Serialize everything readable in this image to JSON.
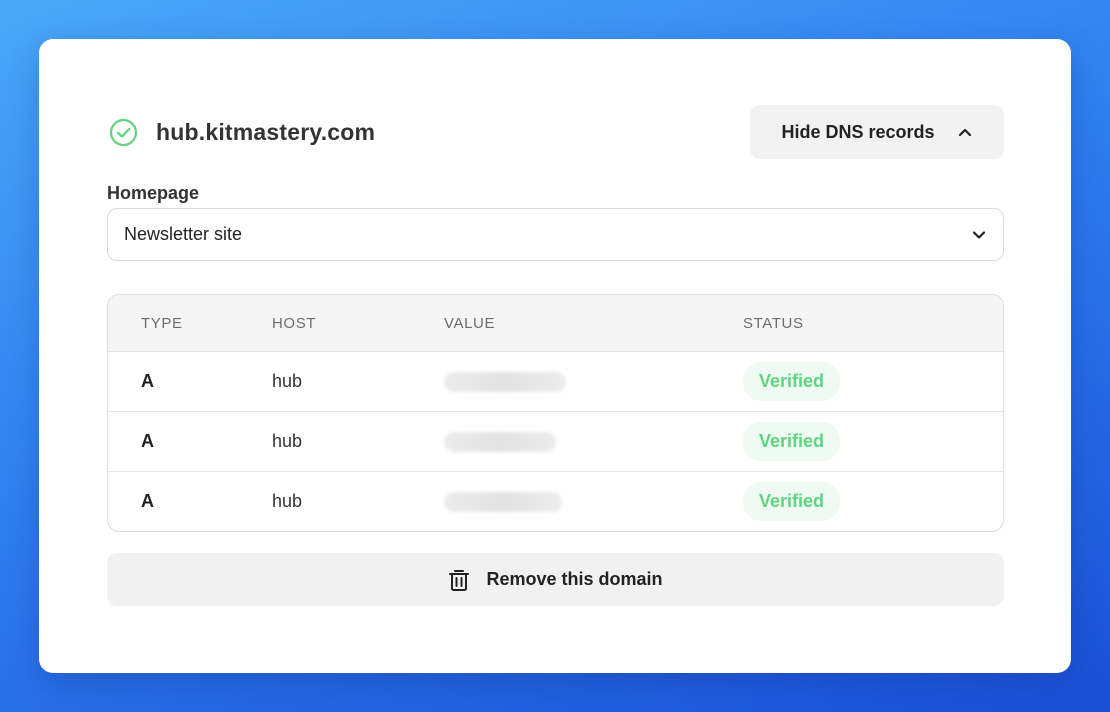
{
  "domain": {
    "name": "hub.kitmastery.com",
    "status_icon": "check-circle-icon",
    "status_color": "#5fd47f"
  },
  "dns_toggle": {
    "label": "Hide DNS records",
    "icon": "chevron-up-icon"
  },
  "homepage": {
    "label": "Homepage",
    "selected": "Newsletter site",
    "icon": "chevron-down-icon"
  },
  "dns_table": {
    "columns": [
      "TYPE",
      "HOST",
      "VALUE",
      "STATUS"
    ],
    "rows": [
      {
        "type": "A",
        "host": "hub",
        "value_redacted": true,
        "status": "Verified"
      },
      {
        "type": "A",
        "host": "hub",
        "value_redacted": true,
        "status": "Verified"
      },
      {
        "type": "A",
        "host": "hub",
        "value_redacted": true,
        "status": "Verified"
      }
    ]
  },
  "remove": {
    "label": "Remove this domain",
    "icon": "trash-icon"
  }
}
